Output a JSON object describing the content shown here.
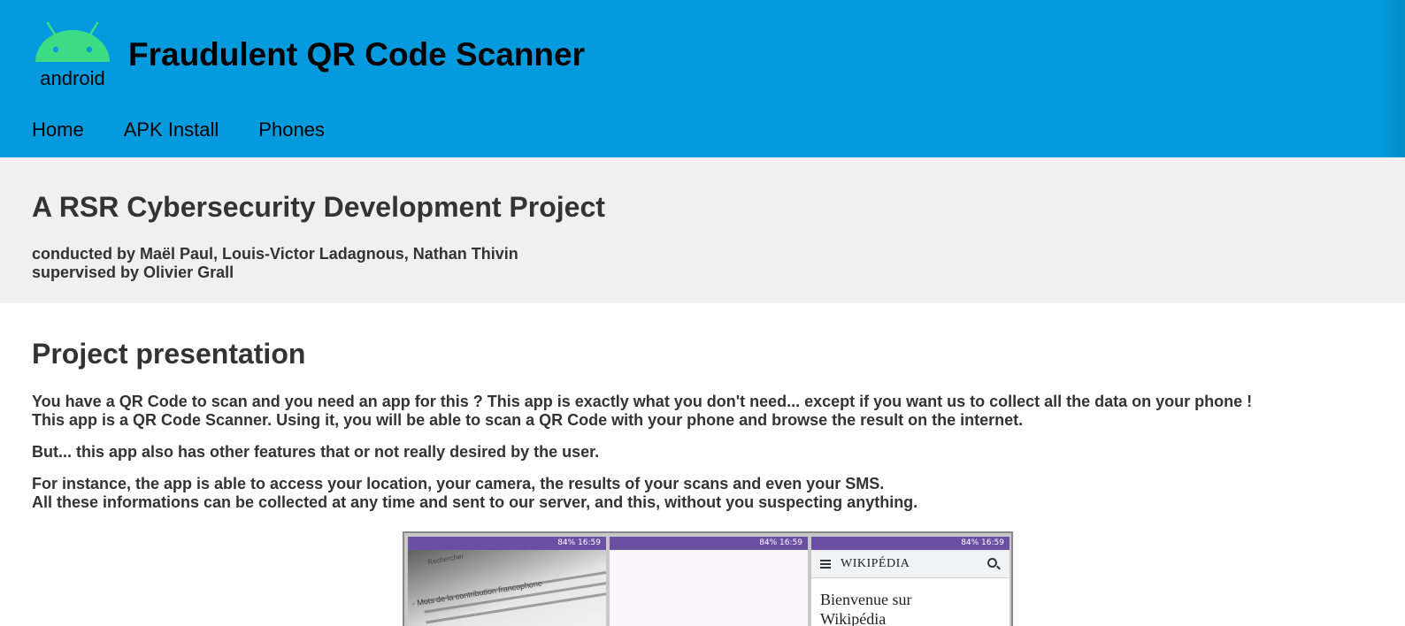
{
  "header": {
    "logo_text": "android",
    "title": "Fraudulent QR Code Scanner",
    "nav": [
      "Home",
      "APK Install",
      "Phones"
    ],
    "colors": {
      "header_bg": "#039bde",
      "android_green": "#3ddc84"
    }
  },
  "banner": {
    "title": "A RSR Cybersecurity Development Project",
    "credits_line1": "conducted by Maël Paul, Louis-Victor Ladagnous, Nathan Thivin",
    "credits_line2": "supervised by Olivier Grall"
  },
  "main": {
    "heading": "Project presentation",
    "p1_line1": "You have a QR Code to scan and you need an app for this ? This app is exactly what you don't need... except if you want us to collect all the data on your phone !",
    "p1_line2": "This app is a QR Code Scanner. Using it, you will be able to scan a QR Code with your phone and browse the result on the internet.",
    "p2": "But... this app also has other features that or not really desired by the user.",
    "p3_line1": "For instance, the app is able to access your location, your camera, the results of your scans and even your SMS.",
    "p3_line2": "All these informations can be collected at any time and sent to our server, and this, without you suspecting anything."
  },
  "screenshots": {
    "status": "84% 16:59",
    "shot1_text": "Rechercher",
    "shot1_line": "- Mots de la contribution francophone",
    "shot3_logo": "WIKIPÉDIA",
    "shot3_body1": "Bienvenue sur",
    "shot3_body2": "Wikipédia"
  }
}
